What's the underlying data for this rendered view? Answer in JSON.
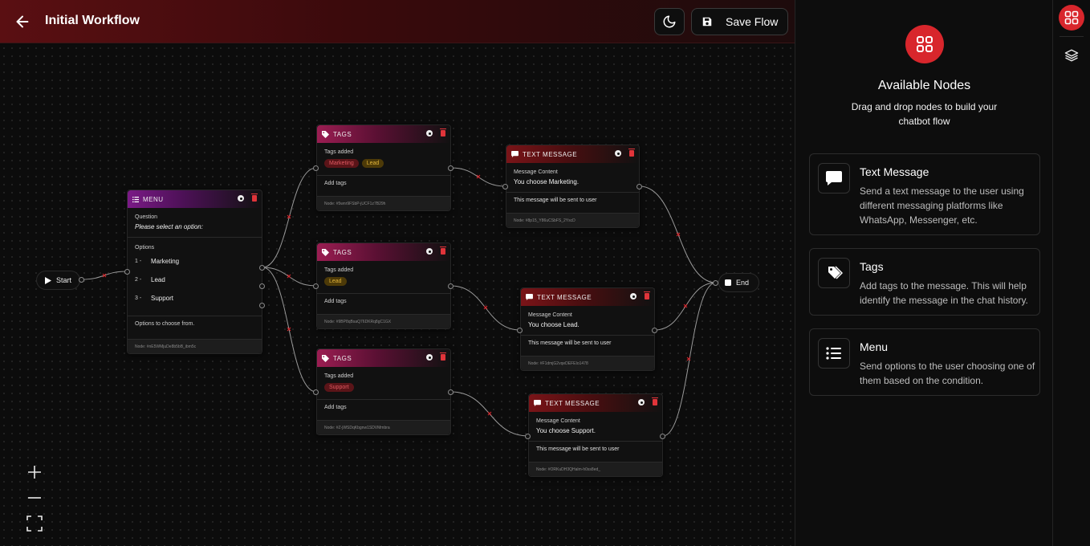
{
  "header": {
    "title": "Initial Workflow",
    "save_label": "Save Flow"
  },
  "canvas": {
    "start_label": "Start",
    "end_label": "End",
    "menu_node": {
      "type_label": "MENU",
      "question_label": "Question",
      "question_value": "Please select an option:",
      "options_label": "Options",
      "options": [
        {
          "num": "1 -",
          "label": "Marketing"
        },
        {
          "num": "2 -",
          "label": "Lead"
        },
        {
          "num": "3 -",
          "label": "Support"
        }
      ],
      "footer_note": "Options to choose from.",
      "node_id": "Node: #nE5WMjuDe8b5bB_ibm5c"
    },
    "tag_nodes": [
      {
        "type_label": "TAGS",
        "tags_label": "Tags added",
        "tags": [
          {
            "text": "Marketing",
            "color": "red"
          },
          {
            "text": "Lead",
            "color": "yellow"
          }
        ],
        "add_label": "Add tags",
        "node_id": "Node: #5wnr9FSbP-jUCF1z7B29h"
      },
      {
        "type_label": "TAGS",
        "tags_label": "Tags added",
        "tags": [
          {
            "text": "Lead",
            "color": "yellow"
          }
        ],
        "add_label": "Add tags",
        "node_id": "Node: #9BP8qBsaQ76DKRq8gC1GX"
      },
      {
        "type_label": "TAGS",
        "tags_label": "Tags added",
        "tags": [
          {
            "text": "Support",
            "color": "red"
          }
        ],
        "add_label": "Add tags",
        "node_id": "Node: #Z-jWSDqKbgnw1SDVMmbra"
      }
    ],
    "text_nodes": [
      {
        "type_label": "TEXT MESSAGE",
        "content_label": "Message Content",
        "content": "You choose Marketing.",
        "note": "This message will be sent to user",
        "node_id": "Node: #8p15_Y86uCSbFS_2YscD"
      },
      {
        "type_label": "TEXT MESSAGE",
        "content_label": "Message Content",
        "content": "You choose Lead.",
        "note": "This message will be sent to user",
        "node_id": "Node: #F1dmjG2vqeDEFEIo1478"
      },
      {
        "type_label": "TEXT MESSAGE",
        "content_label": "Message Content",
        "content": "You choose Support.",
        "note": "This message will be sent to user",
        "node_id": "Node: #ORKuDH3QHalm-h0ss8ed_"
      }
    ]
  },
  "panel": {
    "title": "Available Nodes",
    "subtitle": "Drag and drop nodes to build your chatbot flow",
    "items": [
      {
        "title": "Text Message",
        "desc": "Send a text message to the user using different messaging platforms like WhatsApp, Messenger, etc."
      },
      {
        "title": "Tags",
        "desc": "Add tags to the message. This will help identify the message in the chat history."
      },
      {
        "title": "Menu",
        "desc": "Send options to the user choosing one of them based on the condition."
      }
    ]
  },
  "colors": {
    "accent": "#d8262c",
    "menu_header": "#7a1a86",
    "tags_header": "#9b1d52",
    "text_header": "#7a1418",
    "chip_red": "#e05a62",
    "chip_yellow": "#e1b43a"
  }
}
